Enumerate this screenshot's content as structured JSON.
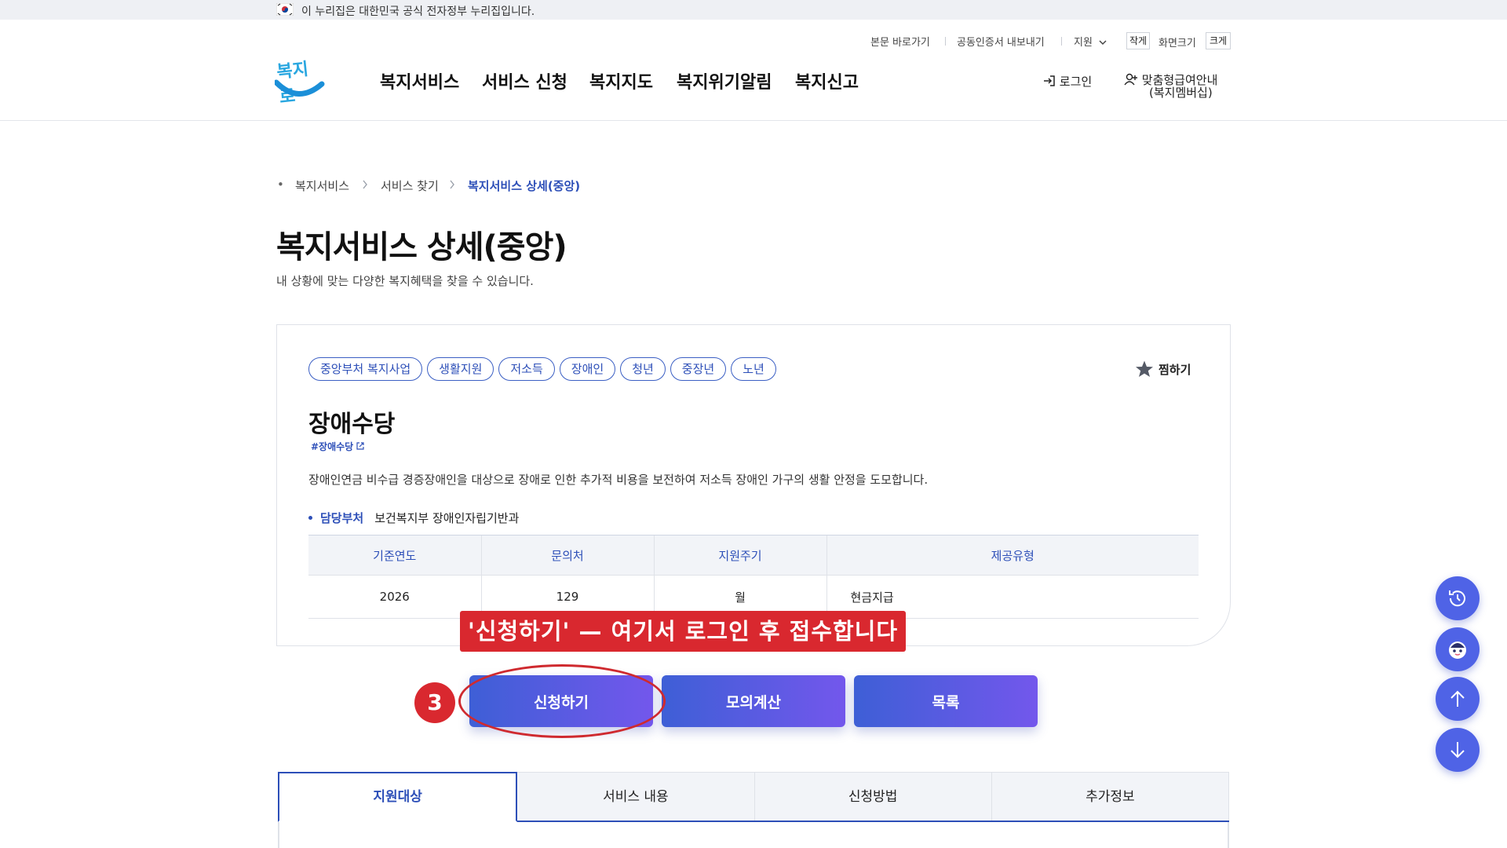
{
  "gov_banner": {
    "text": "이 누리집은 대한민국 공식 전자정부 누리집입니다."
  },
  "header": {
    "util": {
      "skip": "본문 바로가기",
      "cert": "공동인증서 내보내기",
      "support": "지원",
      "small": "작게",
      "screen_size": "화면크기",
      "large": "크게"
    },
    "logo_text": "복지로",
    "nav": [
      "복지서비스",
      "서비스 신청",
      "복지지도",
      "복지위기알림",
      "복지신고"
    ],
    "login": "로그인",
    "membership_line1": "맞춤형급여안내",
    "membership_line2": "(복지멤버십)"
  },
  "breadcrumb": [
    "복지서비스",
    "서비스 찾기",
    "복지서비스 상세(중앙)"
  ],
  "page": {
    "title": "복지서비스 상세(중앙)",
    "description": "내 상황에 맞는 다양한 복지혜택을 찾을 수 있습니다."
  },
  "service": {
    "tags": [
      "중앙부처 복지사업",
      "생활지원",
      "저소득",
      "장애인",
      "청년",
      "중장년",
      "노년"
    ],
    "favorite": "찜하기",
    "name": "장애수당",
    "hashtag": "#장애수당",
    "description": "장애인연금 비수급 경증장애인을 대상으로 장애로 인한 추가적 비용을 보전하여 저소득 장애인 가구의 생활 안정을 도모합니다.",
    "dept_label": "담당부처",
    "dept_value": "보건복지부 장애인자립기반과",
    "table": {
      "headers": [
        "기준연도",
        "문의처",
        "지원주기",
        "제공유형"
      ],
      "row": [
        "2026",
        "129",
        "월",
        "현금지급"
      ]
    }
  },
  "annotation": {
    "callout": "'신청하기' — 여기서 로그인 후 접수합니다",
    "step": "3"
  },
  "actions": {
    "apply": "신청하기",
    "simulate": "모의계산",
    "list": "목록"
  },
  "tabs": [
    "지원대상",
    "서비스 내용",
    "신청방법",
    "추가정보"
  ],
  "colors": {
    "brand_blue": "#2d4fb8",
    "button_gradient_start": "#3e5fd6",
    "button_gradient_end": "#7357ec",
    "annotation_red": "#d9282f",
    "float_button": "#4f63e6"
  },
  "float_buttons": [
    "history-icon",
    "chatbot-icon",
    "arrow-up-icon",
    "arrow-down-icon"
  ]
}
